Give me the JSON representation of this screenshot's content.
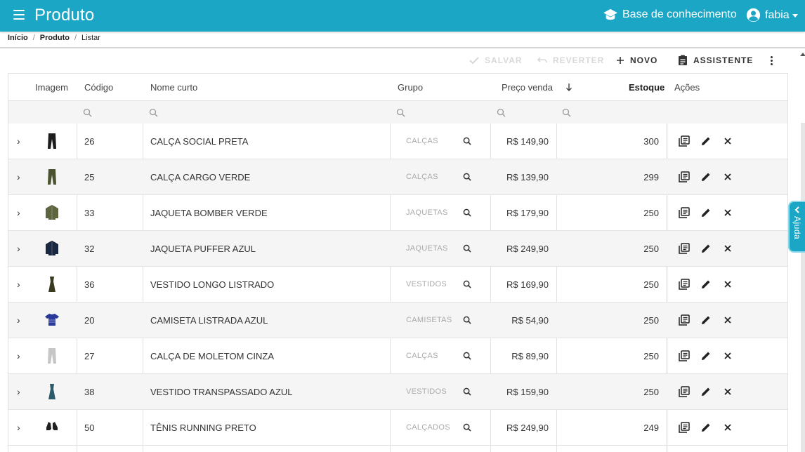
{
  "header": {
    "title": "Produto",
    "knowledge_base": "Base de conhecimento",
    "user": "fabia"
  },
  "breadcrumb": {
    "home": "Início",
    "section": "Produto",
    "current": "Listar"
  },
  "toolbar": {
    "save": "SALVAR",
    "revert": "REVERTER",
    "new": "NOVO",
    "assistant": "ASSISTENTE"
  },
  "table": {
    "columns": {
      "image": "Imagem",
      "code": "Código",
      "name": "Nome curto",
      "group": "Grupo",
      "price": "Preço venda",
      "stock": "Estoque",
      "actions": "Ações"
    },
    "rows": [
      {
        "code": "26",
        "name": "CALÇA SOCIAL PRETA",
        "group": "CALÇAS",
        "price": "R$ 149,90",
        "stock": "300",
        "image_color": "#1c1c1c",
        "shape": "pants"
      },
      {
        "code": "25",
        "name": "CALÇA CARGO VERDE",
        "group": "CALÇAS",
        "price": "R$ 139,90",
        "stock": "299",
        "image_color": "#4a5230",
        "shape": "pants"
      },
      {
        "code": "33",
        "name": "JAQUETA BOMBER VERDE",
        "group": "JAQUETAS",
        "price": "R$ 179,90",
        "stock": "250",
        "image_color": "#5c6440",
        "shape": "jacket"
      },
      {
        "code": "32",
        "name": "JAQUETA PUFFER AZUL",
        "group": "JAQUETAS",
        "price": "R$ 249,90",
        "stock": "250",
        "image_color": "#1a2740",
        "shape": "jacket"
      },
      {
        "code": "36",
        "name": "VESTIDO LONGO LISTRADO",
        "group": "VESTIDOS",
        "price": "R$ 169,90",
        "stock": "250",
        "image_color": "#3a3a20",
        "shape": "dress"
      },
      {
        "code": "20",
        "name": "CAMISETA LISTRADA AZUL",
        "group": "CAMISETAS",
        "price": "R$ 54,90",
        "stock": "250",
        "image_color": "#2a3a9a",
        "shape": "shirt"
      },
      {
        "code": "27",
        "name": "CALÇA DE MOLETOM CINZA",
        "group": "CALÇAS",
        "price": "R$ 89,90",
        "stock": "250",
        "image_color": "#c6c6c6",
        "shape": "pants"
      },
      {
        "code": "38",
        "name": "VESTIDO TRANSPASSADO AZUL",
        "group": "VESTIDOS",
        "price": "R$ 159,90",
        "stock": "250",
        "image_color": "#2d5a6a",
        "shape": "dress"
      },
      {
        "code": "50",
        "name": "TÊNIS RUNNING PRETO",
        "group": "CALÇADOS",
        "price": "R$ 249,90",
        "stock": "249",
        "image_color": "#202020",
        "shape": "shoes"
      }
    ]
  },
  "help": {
    "label": "Ajuda"
  },
  "colors": {
    "primary": "#1ba6c6",
    "disabled": "#d8d8d8",
    "row_alt": "#f5f5f5"
  }
}
